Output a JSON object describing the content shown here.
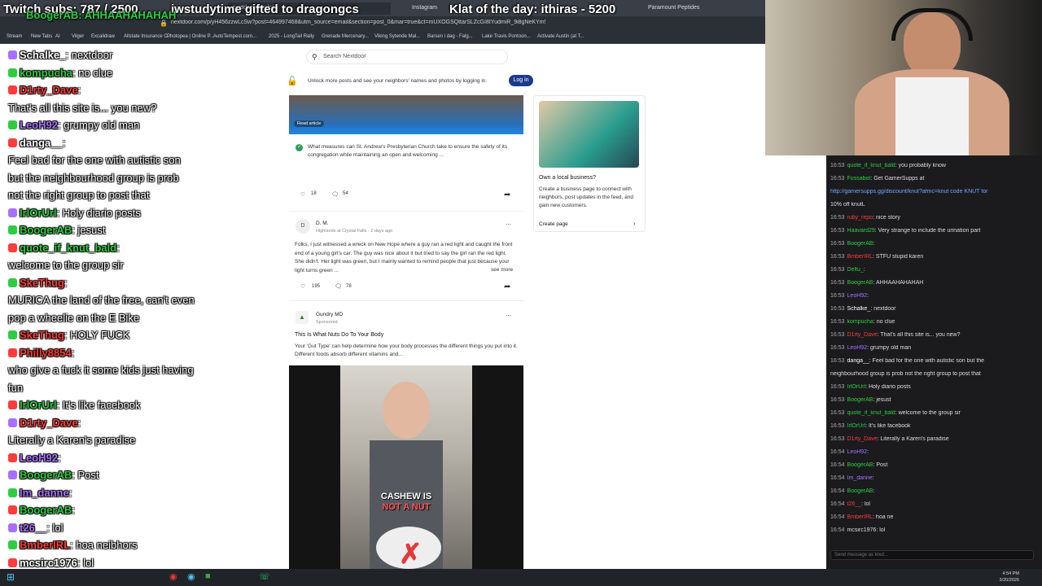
{
  "browser": {
    "tabs": [
      "nextdoor.com/p/...",
      "Instagram",
      "Paramount Peptides"
    ],
    "url": "nextdoor.com/p/yH456zzwLcSw?post=464997468&utm_source=email&section=post_0&mar=true&ct=mUXOGSQttarSLZcGI8IYudmiR_9i8gNeKYm5...",
    "bookmarks": [
      "Stream",
      "New Tabs",
      "AI",
      "Vilger",
      "Excalidraw",
      "Allstate Insurance C...",
      "Photopea | Online P...",
      "AutoTempest.com...",
      "2025 - LongTail Rally",
      "Grenade Mercenary...",
      "Viking Sytende Mal...",
      "Barsen i dag - Falg...",
      "Lake Travis Pontoon...",
      "Activate Austin (at T..."
    ]
  },
  "overlay": {
    "subs": "Twitch subs: 787 / 2500",
    "gift": "iwstudytime gifted to dragongcs",
    "klat": "Klat of the day: ithiras - 5200",
    "left_user": "BoogerAB: AHHAAHAHAHAH"
  },
  "nextdoor": {
    "search_placeholder": "Search Nextdoor",
    "unlock_text": "Unlock more posts and see your neighbors' names and photos by logging in.",
    "login_label": "Log in",
    "read_article": "Read article",
    "post1": {
      "text": "What measures can St. Andrew's Presbyterian Church take to ensure the safety of its congregation while maintaining an open and welcoming ...",
      "likes": "18",
      "comments": "54"
    },
    "post2": {
      "avatar": "D",
      "author": "D. M.",
      "meta": "Highlands at Crystal Falls · 2 days ago",
      "text": "Folks, I just witnessed a wreck on New Hope where a guy ran a red light and caught the front end of a young girl's car. The guy was nice about it but tried to say the girl ran the red light. She didn't. Her light was green, but I mainly wanted to remind people that just because your light turns green ...",
      "see_more": "see more",
      "likes": "195",
      "comments": "78"
    },
    "ad": {
      "author": "Gundry MD",
      "meta": "Sponsored",
      "title": "This Is What Nuts Do To Your Body",
      "text": "Your 'Gut Type' can help determine how your body processes the different things you put into it. Different foods absorb different vitamins and...",
      "see_more": "see more",
      "video_caption_1": "CASHEW IS",
      "video_caption_2": "NOT A NUT"
    },
    "business": {
      "title": "Own a local business?",
      "text": "Create a business page to connect with neighbors, post updates in the feed, and gain new customers.",
      "cta": "Create page"
    }
  },
  "left_chat": [
    {
      "user": "Schalke_",
      "color": "#ffffff",
      "msg": ": nextdoor"
    },
    {
      "user": "kompucha",
      "color": "#2ecc40",
      "msg": ": no clue"
    },
    {
      "user": "D1rty_Dave",
      "color": "#ff3b3b",
      "msg": ":"
    },
    {
      "user": "",
      "color": "#ffffff",
      "msg": "That's all this site is... you new?"
    },
    {
      "user": "LeoH92",
      "color": "#a970ff",
      "msg": ": grumpy old man"
    },
    {
      "user": "danga__",
      "color": "#ffffff",
      "msg": ":"
    },
    {
      "user": "",
      "color": "#ffffff",
      "msg": "Feel bad for the one with autistic son"
    },
    {
      "user": "",
      "color": "#ffffff",
      "msg": "but the neighbourhood group is prob"
    },
    {
      "user": "",
      "color": "#ffffff",
      "msg": "not the right group to post that"
    },
    {
      "user": "IrlOrUrl",
      "color": "#2ecc40",
      "msg": ": Holy diario posts"
    },
    {
      "user": "BoogerAB",
      "color": "#2ecc40",
      "msg": ": jesust"
    },
    {
      "user": "quote_if_knut_bald",
      "color": "#2ecc40",
      "msg": ":"
    },
    {
      "user": "",
      "color": "#ffffff",
      "msg": "welcome to the group sir"
    },
    {
      "user": "SkeThug",
      "color": "#ff3b3b",
      "msg": ":"
    },
    {
      "user": "",
      "color": "#ffffff",
      "msg": "MURICA the land of the free, can't even"
    },
    {
      "user": "",
      "color": "#ffffff",
      "msg": "pop a wheelie on the E Bike"
    },
    {
      "user": "SkeThug",
      "color": "#ff3b3b",
      "msg": ": HOLY FUCK"
    },
    {
      "user": "Philly8854",
      "color": "#ff3b3b",
      "msg": ":"
    },
    {
      "user": "",
      "color": "#ffffff",
      "msg": "who give a fuck it some kids just having"
    },
    {
      "user": "",
      "color": "#ffffff",
      "msg": "fun"
    },
    {
      "user": "IrlOrUrl",
      "color": "#2ecc40",
      "msg": ": It's like facebook"
    },
    {
      "user": "D1rty_Dave",
      "color": "#ff3b3b",
      "msg": ":"
    },
    {
      "user": "",
      "color": "#ffffff",
      "msg": "Literally a Karen's paradise"
    },
    {
      "user": "LeoH92",
      "color": "#a970ff",
      "msg": ":"
    },
    {
      "user": "BoogerAB",
      "color": "#2ecc40",
      "msg": ": Post"
    },
    {
      "user": "Im_danne",
      "color": "#a970ff",
      "msg": ":"
    },
    {
      "user": "BoogerAB",
      "color": "#2ecc40",
      "msg": ":"
    },
    {
      "user": "t26__",
      "color": "#a970ff",
      "msg": ": lol"
    },
    {
      "user": "BmberIRL",
      "color": "#ff3b3b",
      "msg": ": hoa neibhors"
    },
    {
      "user": "mcsirc1976",
      "color": "#ffffff",
      "msg": ": lol"
    }
  ],
  "right_chat": [
    {
      "time": "16:53",
      "user": "quote_if_knut_bald",
      "color": "#2ecc40",
      "msg": ": you probably know"
    },
    {
      "time": "16:53",
      "user": "Fossabot",
      "color": "#2ecc40",
      "msg": ": Get GamerSupps at"
    },
    {
      "time": "",
      "user": "",
      "color": "#6fa8ff",
      "msg": "http://gamersupps.gg/discount/knut?afmc=knut code KNUT for"
    },
    {
      "time": "",
      "user": "",
      "color": "#dddddd",
      "msg": "10% off knutL"
    },
    {
      "time": "16:53",
      "user": "ruby_repo",
      "color": "#ff3b3b",
      "msg": ": nice story"
    },
    {
      "time": "16:53",
      "user": "Haavard29",
      "color": "#2ecc40",
      "msg": ": Very strange to include the urination part"
    },
    {
      "time": "16:53",
      "user": "BoogerAB",
      "color": "#2ecc40",
      "msg": ":"
    },
    {
      "time": "16:53",
      "user": "BmberIRL",
      "color": "#ff3b3b",
      "msg": ": STFU stupid karen"
    },
    {
      "time": "16:53",
      "user": "Deltu_",
      "color": "#2ecc40",
      "msg": ":"
    },
    {
      "time": "16:53",
      "user": "BoogerAB",
      "color": "#2ecc40",
      "msg": ": AHHAAHAHAHAH"
    },
    {
      "time": "16:53",
      "user": "LeoH92",
      "color": "#a970ff",
      "msg": ":"
    },
    {
      "time": "16:53",
      "user": "Schalke_",
      "color": "#ffffff",
      "msg": ": nextdoor"
    },
    {
      "time": "16:53",
      "user": "kompucha",
      "color": "#2ecc40",
      "msg": ": no clue"
    },
    {
      "time": "16:53",
      "user": "D1rty_Dave",
      "color": "#ff3b3b",
      "msg": ": That's all this site is... you new?"
    },
    {
      "time": "16:53",
      "user": "LeoH92",
      "color": "#a970ff",
      "msg": ": grumpy old man"
    },
    {
      "time": "16:53",
      "user": "danga__",
      "color": "#ffffff",
      "msg": ": Feel bad for the one with autistic son but the"
    },
    {
      "time": "",
      "user": "",
      "color": "#dddddd",
      "msg": "neighbourhood group is prob not the right group to post that"
    },
    {
      "time": "16:53",
      "user": "IrlOrUrl",
      "color": "#2ecc40",
      "msg": ": Holy diario posts"
    },
    {
      "time": "16:53",
      "user": "BoogerAB",
      "color": "#2ecc40",
      "msg": ": jesust"
    },
    {
      "time": "16:53",
      "user": "quote_if_knut_bald",
      "color": "#2ecc40",
      "msg": ": welcome to the group sir"
    },
    {
      "time": "16:53",
      "user": "IrlOrUrl",
      "color": "#2ecc40",
      "msg": ": It's like facebook"
    },
    {
      "time": "16:53",
      "user": "D1rty_Dave",
      "color": "#ff3b3b",
      "msg": ": Literally a Karen's paradise"
    },
    {
      "time": "16:54",
      "user": "LeoH92",
      "color": "#a970ff",
      "msg": ":"
    },
    {
      "time": "16:54",
      "user": "BoogerAB",
      "color": "#2ecc40",
      "msg": ": Post"
    },
    {
      "time": "16:54",
      "user": "Im_danne",
      "color": "#a970ff",
      "msg": ":"
    },
    {
      "time": "16:54",
      "user": "BoogerAB",
      "color": "#2ecc40",
      "msg": ":"
    },
    {
      "time": "16:54",
      "user": "t26__",
      "color": "#ff3b3b",
      "msg": ": lol"
    },
    {
      "time": "16:54",
      "user": "BmberIRL",
      "color": "#ff3b3b",
      "msg": ": hoa ne"
    },
    {
      "time": "16:54",
      "user": "mcsirc1976",
      "color": "#dddddd",
      "msg": ": lol"
    }
  ],
  "chat_input_placeholder": "Send message as knut...",
  "clock": {
    "time": "4:54 PM",
    "date": "3/20/2026"
  }
}
